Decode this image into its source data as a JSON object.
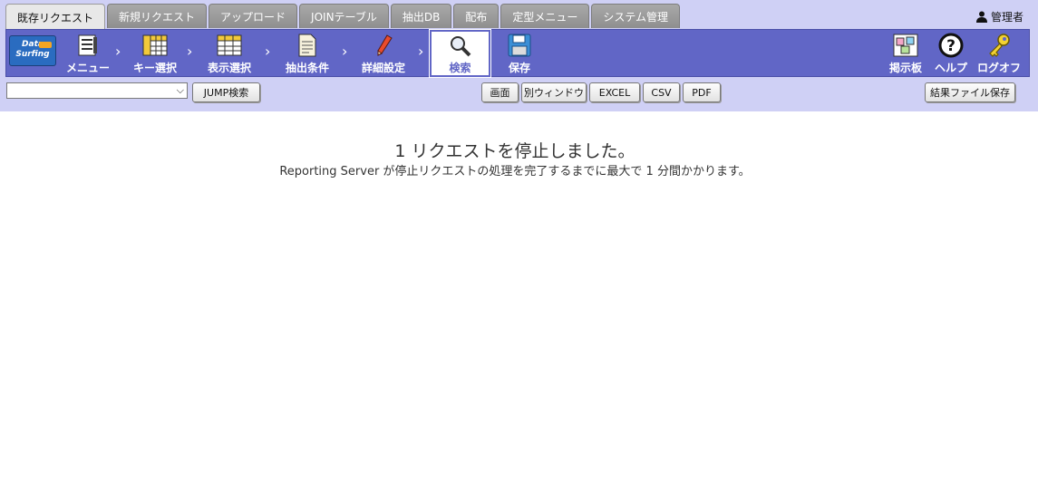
{
  "tabs": [
    {
      "label": "既存リクエスト",
      "active": true
    },
    {
      "label": "新規リクエスト",
      "active": false
    },
    {
      "label": "アップロード",
      "active": false
    },
    {
      "label": "JOINテーブル",
      "active": false
    },
    {
      "label": "抽出DB",
      "active": false
    },
    {
      "label": "配布",
      "active": false
    },
    {
      "label": "定型メニュー",
      "active": false
    },
    {
      "label": "システム管理",
      "active": false
    }
  ],
  "user": {
    "name": "管理者",
    "icon": "user-icon"
  },
  "toolbar": {
    "logo_text": "Data Surfing",
    "steps": [
      {
        "label": "メニュー",
        "icon": "menu-list-icon"
      },
      {
        "label": "キー選択",
        "icon": "key-grid-icon"
      },
      {
        "label": "表示選択",
        "icon": "display-grid-icon"
      },
      {
        "label": "抽出条件",
        "icon": "document-icon"
      },
      {
        "label": "詳細設定",
        "icon": "pencil-icon"
      },
      {
        "label": "検索",
        "icon": "magnifier-icon",
        "active": true
      },
      {
        "label": "保存",
        "icon": "floppy-icon"
      }
    ],
    "right": [
      {
        "label": "掲示板",
        "icon": "bulletin-board-icon"
      },
      {
        "label": "ヘルプ",
        "icon": "help-icon"
      },
      {
        "label": "ログオフ",
        "icon": "key-icon"
      }
    ]
  },
  "controls": {
    "jump_select_value": "",
    "jump_button": "JUMP検索",
    "output_buttons": [
      "画面",
      "別ウィンドウ",
      "EXCEL",
      "CSV",
      "PDF"
    ],
    "save_result_button": "結果ファイル保存"
  },
  "message": {
    "title": "1 リクエストを停止しました。",
    "subtitle": "Reporting Server が停止リクエストの処理を完了するまでに最大で 1 分間かかります。"
  },
  "colors": {
    "toolbar": "#6166c6",
    "band": "#cfd0f5",
    "tab": "#9c9c9c"
  }
}
